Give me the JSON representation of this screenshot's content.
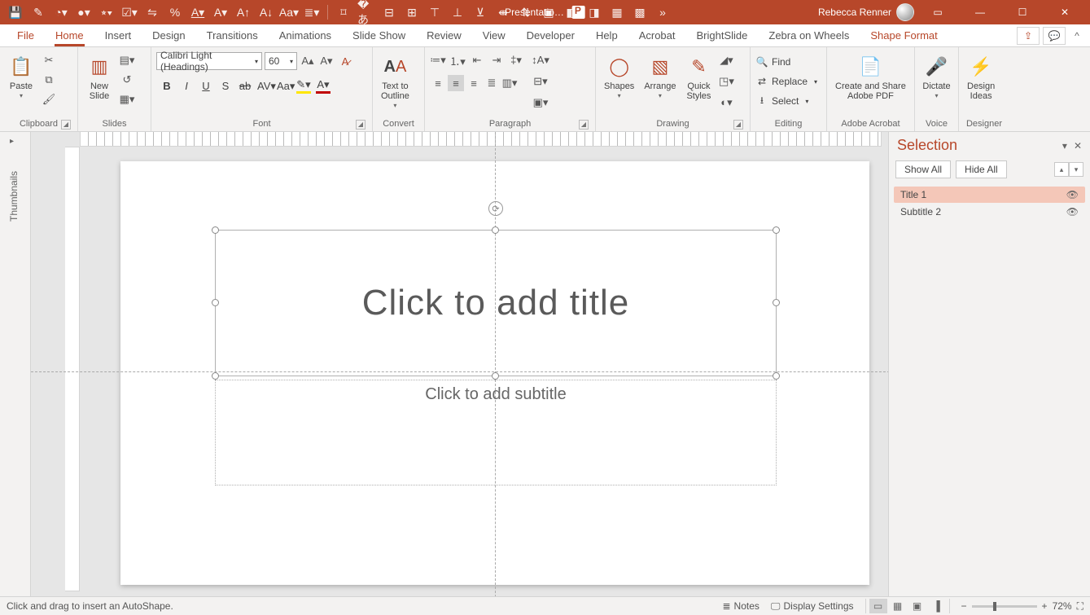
{
  "app": {
    "document_title": "Presentatio…",
    "user_name": "Rebecca Renner"
  },
  "tabs": {
    "file": "File",
    "home": "Home",
    "insert": "Insert",
    "design": "Design",
    "transitions": "Transitions",
    "animations": "Animations",
    "slideshow": "Slide Show",
    "review": "Review",
    "view": "View",
    "developer": "Developer",
    "help": "Help",
    "acrobat": "Acrobat",
    "brightslide": "BrightSlide",
    "zebra": "Zebra on Wheels",
    "shapeformat": "Shape Format"
  },
  "ribbon": {
    "clipboard": {
      "label": "Clipboard",
      "paste": "Paste"
    },
    "slides": {
      "label": "Slides",
      "new_slide": "New\nSlide"
    },
    "font": {
      "label": "Font",
      "name": "Calibri Light (Headings)",
      "size": "60"
    },
    "convert": {
      "label": "Convert",
      "text_to_outline": "Text to\nOutline"
    },
    "paragraph": {
      "label": "Paragraph"
    },
    "drawing": {
      "label": "Drawing",
      "shapes": "Shapes",
      "arrange": "Arrange",
      "quick_styles": "Quick\nStyles"
    },
    "editing": {
      "label": "Editing",
      "find": "Find",
      "replace": "Replace",
      "select": "Select"
    },
    "acrobat": {
      "label": "Adobe Acrobat",
      "create": "Create and Share\nAdobe PDF"
    },
    "voice": {
      "label": "Voice",
      "dictate": "Dictate"
    },
    "designer": {
      "label": "Designer",
      "ideas": "Design\nIdeas"
    }
  },
  "thumbnails": {
    "label": "Thumbnails"
  },
  "slide": {
    "title_placeholder": "Click to add title",
    "subtitle_placeholder": "Click to add subtitle"
  },
  "selection_pane": {
    "title": "Selection",
    "show_all": "Show All",
    "hide_all": "Hide All",
    "items": [
      {
        "name": "Title 1",
        "selected": true
      },
      {
        "name": "Subtitle 2",
        "selected": false
      }
    ]
  },
  "status": {
    "hint": "Click and drag to insert an AutoShape.",
    "notes": "Notes",
    "display": "Display Settings",
    "zoom": "72%"
  }
}
